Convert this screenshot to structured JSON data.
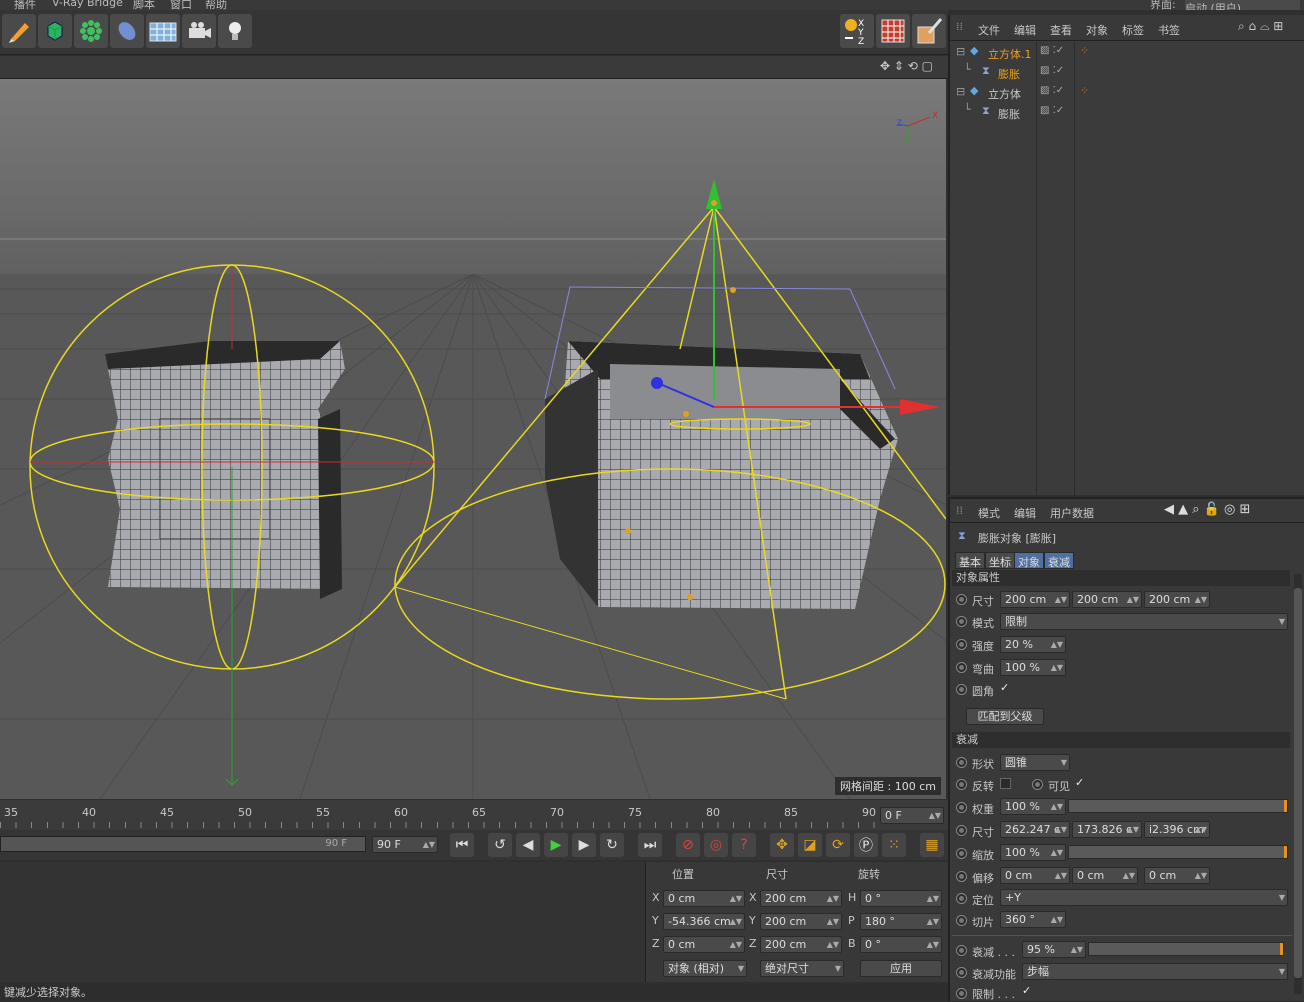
{
  "menubar": {
    "items": [
      "播件",
      "V-Ray Bridge",
      "脚本",
      "窗口",
      "帮助"
    ],
    "layout_label": "界面:",
    "layout_value": "启动 (用户)"
  },
  "viewport": {
    "grid_spacing": "网格间距 : 100 cm",
    "axis": {
      "x": "X",
      "y": "Y",
      "z": "Z"
    }
  },
  "timeline": {
    "ticks": [
      "35",
      "40",
      "45",
      "50",
      "55",
      "60",
      "65",
      "70",
      "75",
      "80",
      "85",
      "90"
    ],
    "current_frame": "0 F"
  },
  "transport": {
    "end_frame_display": "90 F",
    "end_frame_field": "90 F"
  },
  "object_manager": {
    "menu": [
      "文件",
      "编辑",
      "查看",
      "对象",
      "标签",
      "书签"
    ],
    "objects": [
      {
        "name": "立方体.1",
        "color": "#e8a020",
        "indent": 0
      },
      {
        "name": "膨胀",
        "color": "#e8a020",
        "indent": 1
      },
      {
        "name": "立方体",
        "color": "#c8c8c8",
        "indent": 0
      },
      {
        "name": "膨胀",
        "color": "#c8c8c8",
        "indent": 1
      }
    ]
  },
  "attributes": {
    "menu": [
      "模式",
      "编辑",
      "用户数据"
    ],
    "title": "膨胀对象 [膨胀]",
    "tabs": [
      "基本",
      "坐标",
      "对象",
      "衰减"
    ],
    "object_section": "对象属性",
    "size_label": "尺寸",
    "size": [
      "200 cm",
      "200 cm",
      "200 cm"
    ],
    "mode_label": "模式",
    "mode": "限制",
    "strength_label": "强度",
    "strength": "20 %",
    "curvature_label": "弯曲",
    "curvature": "100 %",
    "round_label": "圆角",
    "fit_parent": "匹配到父级",
    "falloff_section": "衰减",
    "shape_label": "形状",
    "shape": "圆锥",
    "invert_label": "反转",
    "visible_label": "可见",
    "weight_label": "权重",
    "weight": "100 %",
    "fsize_label": "尺寸",
    "fsize": [
      "262.247 c",
      "173.826 c",
      "i2.396 cm"
    ],
    "scale_label": "缩放",
    "scale": "100 %",
    "offset_label": "偏移",
    "offset": [
      "0 cm",
      "0 cm",
      "0 cm"
    ],
    "orient_label": "定位",
    "orient": "+Y",
    "slice_label": "切片",
    "slice": "360 °",
    "fade_label": "衰减 . . .",
    "fade": "95 %",
    "fade_func_label": "衰减功能",
    "fade_func": "步幅",
    "limit_label": "限制 . . ."
  },
  "coordinates": {
    "headers": [
      "位置",
      "尺寸",
      "旋转"
    ],
    "pos": [
      {
        "axis": "X",
        "value": "0 cm"
      },
      {
        "axis": "Y",
        "value": "-54.366 cm"
      },
      {
        "axis": "Z",
        "value": "0 cm"
      }
    ],
    "size": [
      {
        "axis": "X",
        "value": "200 cm"
      },
      {
        "axis": "Y",
        "value": "200 cm"
      },
      {
        "axis": "Z",
        "value": "200 cm"
      }
    ],
    "rot": [
      {
        "axis": "H",
        "value": "0 °"
      },
      {
        "axis": "P",
        "value": "180 °"
      },
      {
        "axis": "B",
        "value": "0 °"
      }
    ],
    "mode_dropdown": "对象 (相对)",
    "size_dropdown": "绝对尺寸",
    "apply": "应用"
  },
  "status": "键减少选择对象。"
}
